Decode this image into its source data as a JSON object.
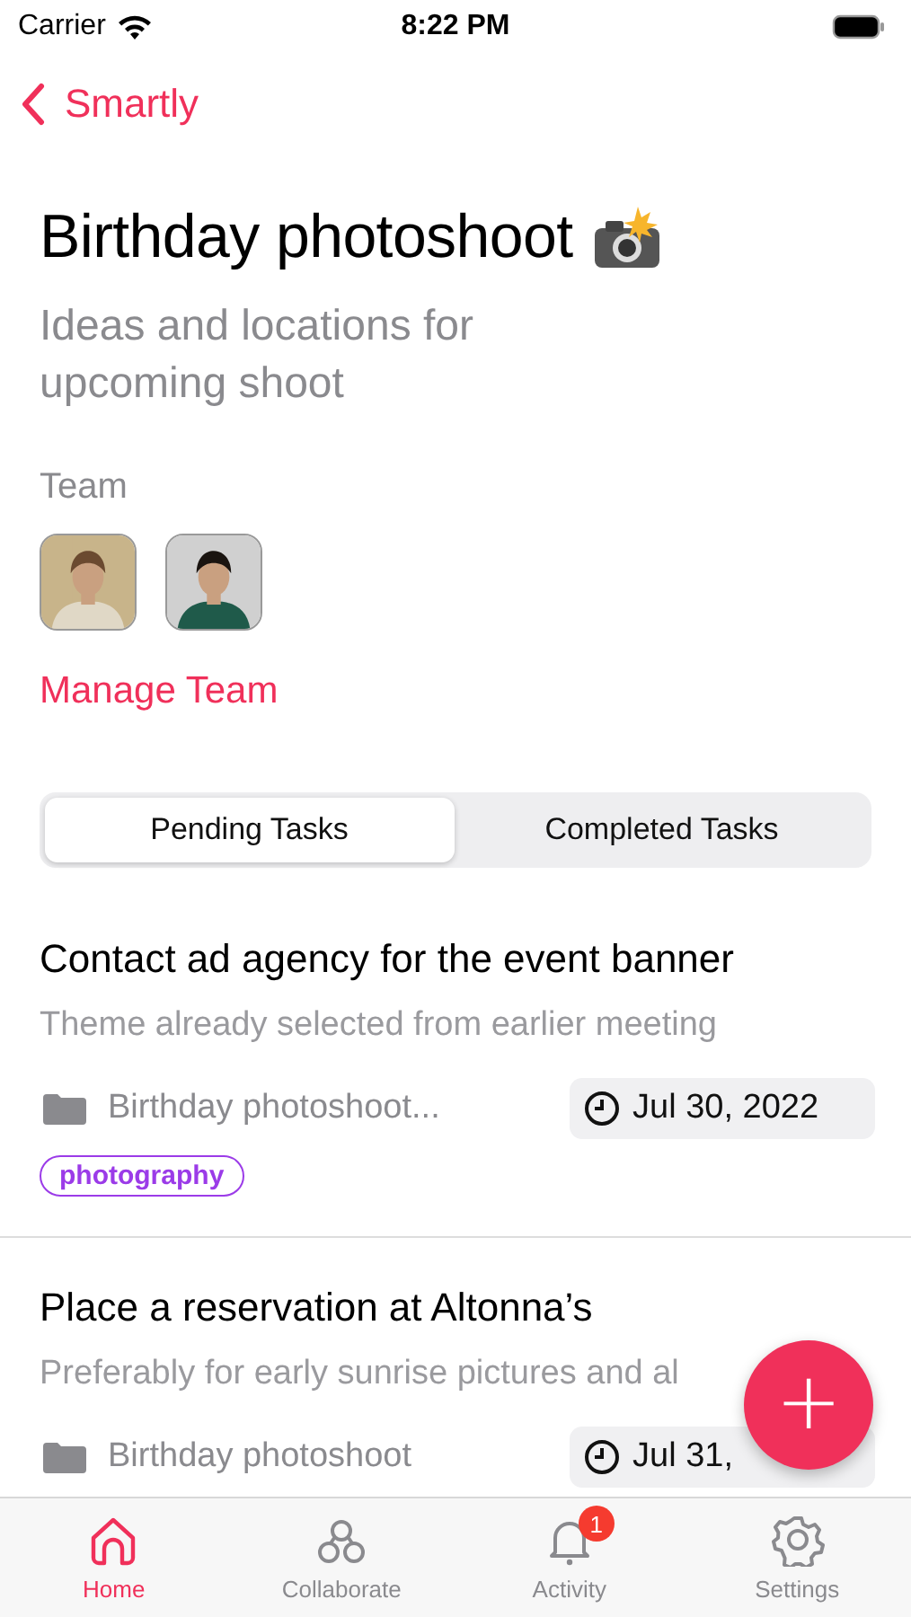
{
  "status_bar": {
    "carrier": "Carrier",
    "time": "8:22 PM"
  },
  "nav": {
    "back_label": "Smartly"
  },
  "project": {
    "title": "Birthday photoshoot",
    "description": "Ideas and locations for upcoming shoot"
  },
  "team": {
    "label": "Team",
    "manage_label": "Manage Team"
  },
  "segments": [
    {
      "label": "Pending Tasks",
      "selected": true
    },
    {
      "label": "Completed Tasks",
      "selected": false
    }
  ],
  "tasks": [
    {
      "title": "Contact ad agency for the event banner",
      "description": "Theme already selected from earlier meeting",
      "project": "Birthday photoshoot...",
      "due": "Jul 30, 2022",
      "tags": [
        {
          "label": "photography",
          "color": "#9b3be8"
        }
      ]
    },
    {
      "title": "Place a reservation at Altonna’s",
      "description": "Preferably for early sunrise pictures and al",
      "project": "Birthday photoshoot",
      "due": "Jul 31,"
    }
  ],
  "fab": {
    "label": "+"
  },
  "tab_bar": [
    {
      "label": "Home",
      "kind": "home",
      "selected": true
    },
    {
      "label": "Collaborate",
      "kind": "collaborate",
      "selected": false
    },
    {
      "label": "Activity",
      "kind": "activity",
      "selected": false,
      "badge": "1"
    },
    {
      "label": "Settings",
      "kind": "settings",
      "selected": false
    }
  ]
}
